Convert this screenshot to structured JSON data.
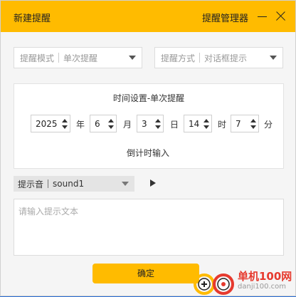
{
  "window": {
    "title": "新建提醒",
    "manager_link": "提醒管理器"
  },
  "reminder_mode": {
    "label": "提醒模式",
    "value": "单次提醒"
  },
  "reminder_method": {
    "label": "提醒方式",
    "value": "对话框提示"
  },
  "time_settings": {
    "title": "时间设置-单次提醒",
    "year": {
      "value": "2025",
      "unit": "年"
    },
    "month": {
      "value": "6",
      "unit": "月"
    },
    "day": {
      "value": "3",
      "unit": "日"
    },
    "hour": {
      "value": "14",
      "unit": "时"
    },
    "minute": {
      "value": "7",
      "unit": "分"
    },
    "countdown_link": "倒计时输入"
  },
  "sound": {
    "label": "提示音",
    "value": "sound1"
  },
  "text_input": {
    "placeholder": "请输入提示文本"
  },
  "confirm_label": "确定",
  "watermark": {
    "brand": "单机100网",
    "url": "danji100.com"
  },
  "colors": {
    "accent": "#ffbb00",
    "watermark_red": "#e63a2e"
  }
}
